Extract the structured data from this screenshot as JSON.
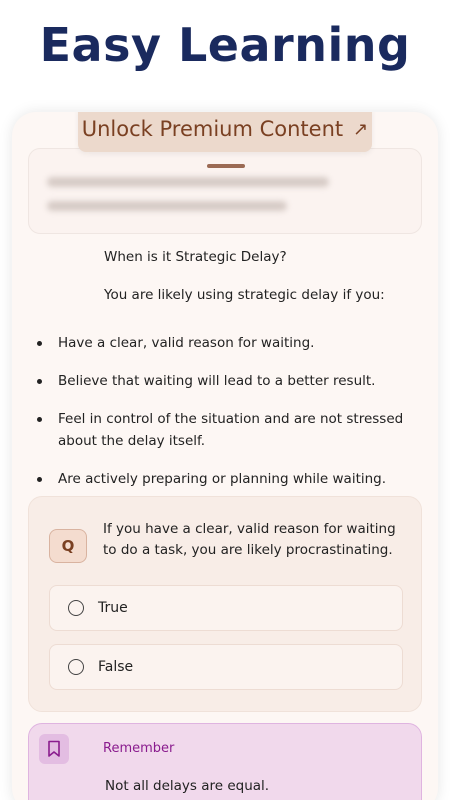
{
  "header": {
    "title": "Easy Learning"
  },
  "premium": {
    "label": "Unlock Premium Content",
    "icon": "arrow-up-right-icon"
  },
  "lesson": {
    "heading": "When is it Strategic Delay?",
    "intro": "You are likely using strategic delay if you:",
    "bullets": [
      "Have a clear, valid reason for waiting.",
      "Believe that waiting will lead to a better result.",
      "Feel in control of the situation and are not stressed about the delay itself.",
      "Are actively preparing or planning while waiting."
    ]
  },
  "quiz": {
    "badge": "Q",
    "question": "If you have a clear, valid reason for waiting to do a task, you are likely procrastinating.",
    "options": [
      "True",
      "False"
    ]
  },
  "remember": {
    "title": "Remember",
    "body": "Not all delays are equal.",
    "icon": "bookmark-icon"
  },
  "colors": {
    "headline": "#1a2a5e",
    "accent_brown": "#7a4022",
    "remember_purple": "#8a1c8e"
  }
}
